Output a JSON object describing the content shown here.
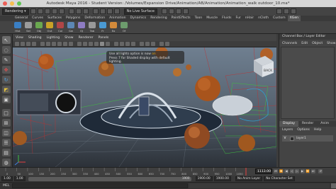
{
  "window": {
    "title": "Autodesk Maya 2016 - Student Version: /Volumes/Expansion Drive/Animation/AB/Animation/Animation_walk outdoor_10.ma*"
  },
  "menubar": {
    "mode_dropdown": "Rendering",
    "surface_dropdown": "No Live Surface"
  },
  "shelf_tabs": [
    "General",
    "Curves",
    "Surfaces",
    "Polygons",
    "Deformation",
    "Animation",
    "Dynamics",
    "Rendering",
    "PaintEffects",
    "Toon",
    "Muscle",
    "Fluids",
    "Fur",
    "nHair",
    "nCloth",
    "Custom",
    "XGen"
  ],
  "active_shelf_tab": "XGen",
  "shelf_buttons": [
    "Hist",
    "Sel",
    "Obj",
    "Out",
    "Col",
    "Gw",
    "OJ",
    "Tab",
    "Fr",
    "Eo",
    "Of"
  ],
  "panel_menu": [
    "View",
    "Shading",
    "Lighting",
    "Show",
    "Renderer",
    "Panels"
  ],
  "viewport_message": {
    "line1_prefix": "Use all lights option is now ",
    "line1_status": "on",
    "line2": "Press 7 for Shaded display with default lighting."
  },
  "view_cube": {
    "label": "BACK"
  },
  "channel_box": {
    "title": "Channel Box / Layer Editor",
    "menu": [
      "Channels",
      "Edit",
      "Object",
      "Show"
    ]
  },
  "layer_editor": {
    "tabs": [
      "Display",
      "Render",
      "Anim"
    ],
    "active_tab": "Display",
    "menu": [
      "Layers",
      "Options",
      "Help"
    ],
    "layer": {
      "visibility": "V",
      "name": "layer1"
    }
  },
  "timeline": {
    "ticks": [
      "0",
      "50",
      "100",
      "150",
      "200",
      "250",
      "300",
      "350",
      "400",
      "450",
      "500",
      "550",
      "600",
      "650",
      "700",
      "750",
      "800",
      "850",
      "900",
      "950",
      "1000",
      "1050"
    ],
    "current_frame": "1113.00"
  },
  "range": {
    "start": "1.00",
    "inner_start": "1.00",
    "end_field": "1900",
    "end_value": "1900.00",
    "end2": "1900.00",
    "anim_layer": "No Anim Layer",
    "char_set": "No Character Set"
  },
  "command_line": {
    "label": "MEL"
  }
}
